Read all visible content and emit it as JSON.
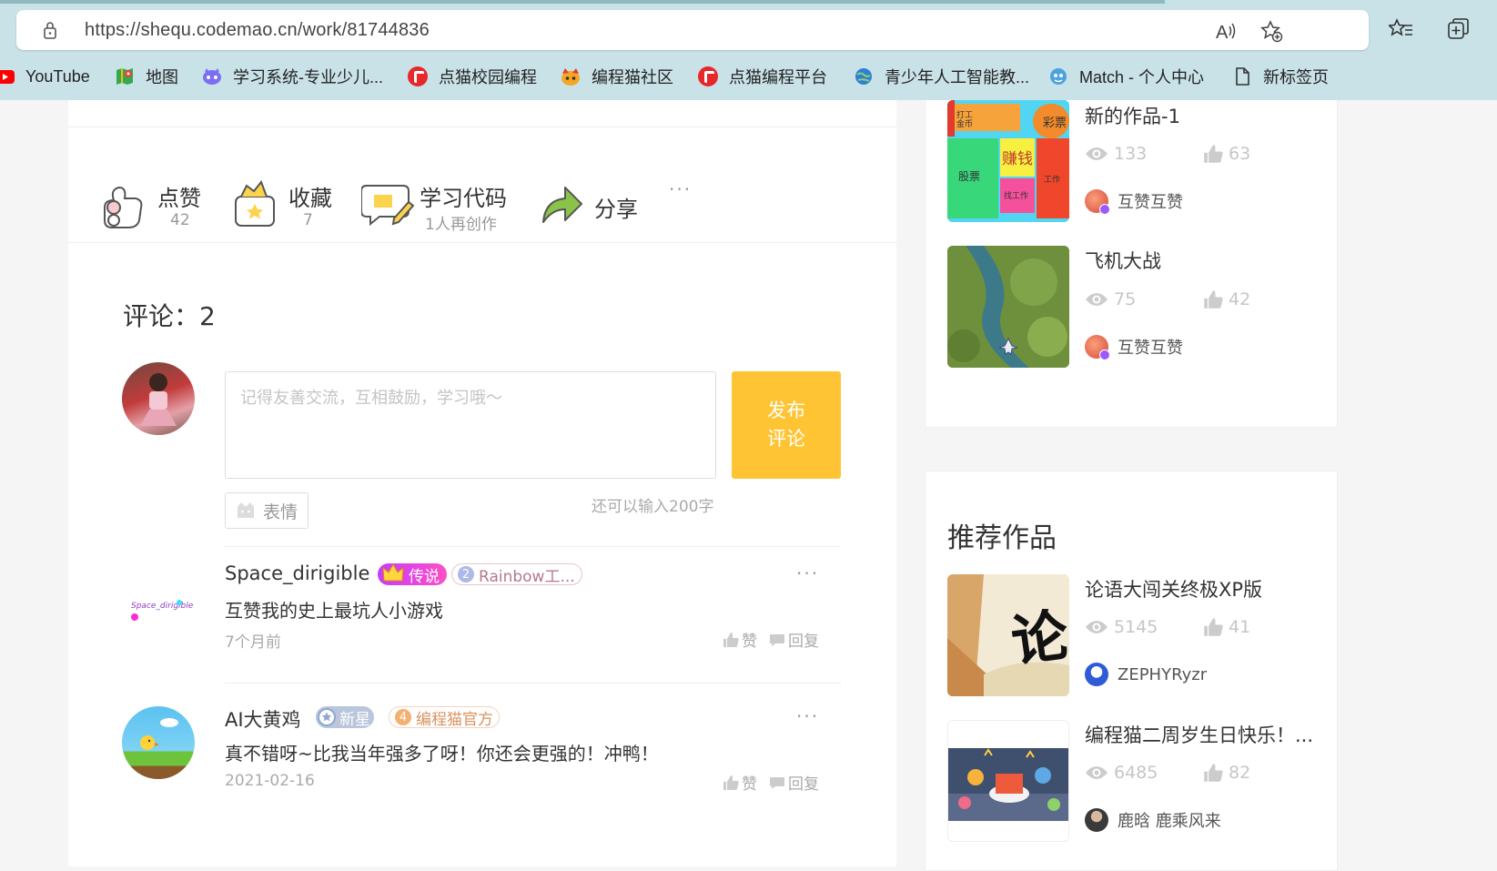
{
  "browser": {
    "url": "https://shequ.codemao.cn/work/81744836",
    "bookmarks": [
      {
        "label": "YouTube"
      },
      {
        "label": "地图"
      },
      {
        "label": "学习系统-专业少儿..."
      },
      {
        "label": "点猫校园编程"
      },
      {
        "label": "编程猫社区"
      },
      {
        "label": "点猫编程平台"
      },
      {
        "label": "青少年人工智能教..."
      },
      {
        "label": "Match - 个人中心"
      },
      {
        "label": "新标签页"
      }
    ]
  },
  "actions": {
    "like": {
      "label": "点赞",
      "count": "42"
    },
    "collect": {
      "label": "收藏",
      "count": "7"
    },
    "learn": {
      "label": "学习代码",
      "count": "1人再创作"
    },
    "share": {
      "label": "分享"
    },
    "more": "···"
  },
  "comments": {
    "title": "评论：2",
    "placeholder": "记得友善交流，互相鼓励，学习哦～",
    "publish_line1": "发布",
    "publish_line2": "评论",
    "emoji_label": "表情",
    "char_limit": "还可以输入200字",
    "items": [
      {
        "avatar_text": "Space_dirigible",
        "user": "Space_dirigible",
        "badge1": "传说",
        "badge2_num": "2",
        "badge2": "Rainbow工...",
        "text": "互赞我的史上最坑人小游戏",
        "time": "7个月前",
        "like": "赞",
        "reply": "回复",
        "more": "···"
      },
      {
        "user": "AI大黄鸡",
        "badge1": "新星",
        "badge2_num": "4",
        "badge2": "编程猫官方",
        "text": "真不错呀~比我当年强多了呀！你还会更强的！冲鸭！",
        "time": "2021-02-16",
        "like": "赞",
        "reply": "回复",
        "more": "···"
      }
    ]
  },
  "sidebar_works": [
    {
      "title": "新的作品-1",
      "views": "133",
      "likes": "63",
      "author": "互赞互赞",
      "thumb_labels": {
        "money": "赚钱",
        "stock": "股票",
        "lottery": "彩票",
        "work": "工作",
        "job": "找工作",
        "gold": "打工\n金币"
      }
    },
    {
      "title": "飞机大战",
      "views": "75",
      "likes": "42",
      "author": "互赞互赞"
    }
  ],
  "recommended": {
    "heading": "推荐作品",
    "works": [
      {
        "title": "论语大闯关终极XP版",
        "views": "5145",
        "likes": "41",
        "author": "ZEPHYRyzr",
        "thumb_char": "论"
      },
      {
        "title": "编程猫二周岁生日快乐！...",
        "views": "6485",
        "likes": "82",
        "author": "鹿晗 鹿乘风来"
      }
    ]
  },
  "colors": {
    "accent": "#fec433",
    "browser_bg": "#c9e2e8",
    "youtube_red": "#ff0000",
    "codemao_red": "#e8272a"
  }
}
